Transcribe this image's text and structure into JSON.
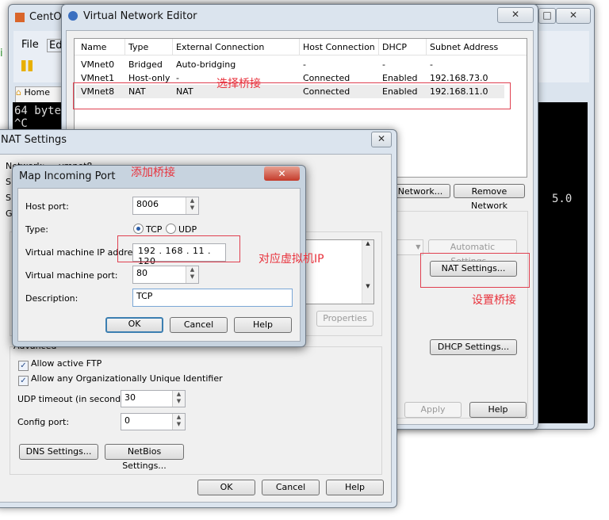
{
  "background_window": {
    "title": "CentO",
    "menu": [
      "File",
      "Ed"
    ],
    "tab": "Home",
    "terminal_lines": [
      "64 byte",
      "^C"
    ],
    "terminal_fragment": "5.0",
    "side_char": "i"
  },
  "vne": {
    "title": "Virtual Network Editor",
    "columns": [
      "Name",
      "Type",
      "External Connection",
      "Host Connection",
      "DHCP",
      "Subnet Address"
    ],
    "rows": [
      [
        "VMnet0",
        "Bridged",
        "Auto-bridging",
        "-",
        "-",
        "-"
      ],
      [
        "VMnet1",
        "Host-only",
        "-",
        "Connected",
        "Enabled",
        "192.168.73.0"
      ],
      [
        "VMnet8",
        "NAT",
        "NAT",
        "Connected",
        "Enabled",
        "192.168.11.0"
      ]
    ],
    "selected_row": 2,
    "add_network": "Network...",
    "remove_network": "Remove Network",
    "automatic_settings": "Automatic Settings...",
    "nat_settings": "NAT Settings...",
    "dhcp_settings": "DHCP Settings...",
    "apply": "Apply",
    "help": "Help"
  },
  "nat": {
    "title": "NAT Settings",
    "network_label": "Network:",
    "network_value": "vmnet8",
    "clipped_labels": [
      "S",
      "S",
      "G"
    ],
    "properties": "Properties",
    "advanced": "Advanced",
    "allow_ftp": "Allow active FTP",
    "allow_ftp_checked": true,
    "allow_oui": "Allow any Organizationally Unique Identifier",
    "allow_oui_checked": true,
    "udp_label": "UDP timeout (in seconds):",
    "udp_value": "30",
    "config_label": "Config port:",
    "config_value": "0",
    "dns": "DNS Settings...",
    "netbios": "NetBios Settings...",
    "ok": "OK",
    "cancel": "Cancel",
    "help": "Help"
  },
  "map": {
    "title": "Map Incoming Port",
    "host_port_label": "Host port:",
    "host_port": "8006",
    "type_label": "Type:",
    "tcp": "TCP",
    "udp": "UDP",
    "selected_type": "TCP",
    "ip_label": "Virtual machine IP address:",
    "ip": [
      "192",
      "168",
      "11",
      "120"
    ],
    "vm_port_label": "Virtual machine port:",
    "vm_port": "80",
    "desc_label": "Description:",
    "desc": "TCP",
    "ok": "OK",
    "cancel": "Cancel",
    "help": "Help"
  },
  "annotations": {
    "select_bridge": "选择桥接",
    "add_bridge": "添加桥接",
    "vm_ip": "对应虚拟机IP",
    "set_bridge": "设置桥接"
  },
  "colors": {
    "annotation": "#e8323c",
    "terminal": "#000000"
  }
}
